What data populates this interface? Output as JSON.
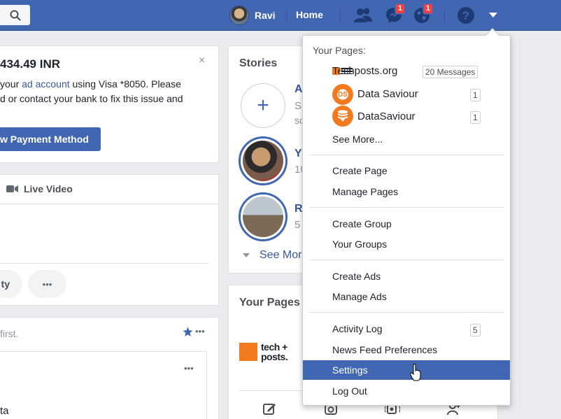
{
  "header": {
    "user_name": "Ravi",
    "home_label": "Home",
    "messages_badge": "1",
    "notifications_badge": "1",
    "accent": "#4267b2"
  },
  "payment": {
    "amount": "434.49 INR",
    "text_line1_a": "your",
    "text_line1_link": "ad account",
    "text_line1_b": "using Visa *8050. Please",
    "text_line2": "d or contact your bank to fix this issue and",
    "button_label": "w Payment Method",
    "close": "×"
  },
  "composer": {
    "live_video_label": "Live Video",
    "chip_label": "ty",
    "more": "•••"
  },
  "feed": {
    "text": "first.",
    "more": "•••",
    "fragment": "ta"
  },
  "stories": {
    "title": "Stories",
    "add": "+",
    "frag_a": "A",
    "frag_s1": "S",
    "frag_s2": "so",
    "frag_y": "Y",
    "frag_1": "10",
    "frag_r": "R",
    "frag_5": "5",
    "see_more": "See Mor"
  },
  "your_pages": {
    "title": "Your Pages",
    "logo_text": "tech + posts."
  },
  "menu": {
    "heading": "Your Pages:",
    "pages": [
      {
        "name": "Techposts.org",
        "count": "20 Messages"
      },
      {
        "name": "Data Saviour",
        "count": "1"
      },
      {
        "name": "DataSaviour",
        "count": "1"
      }
    ],
    "see_more": "See More...",
    "create_page": "Create Page",
    "manage_pages": "Manage Pages",
    "create_group": "Create Group",
    "your_groups": "Your Groups",
    "create_ads": "Create Ads",
    "manage_ads": "Manage Ads",
    "activity_log": "Activity Log",
    "activity_count": "5",
    "news_feed_prefs": "News Feed Preferences",
    "settings": "Settings",
    "log_out": "Log Out"
  }
}
